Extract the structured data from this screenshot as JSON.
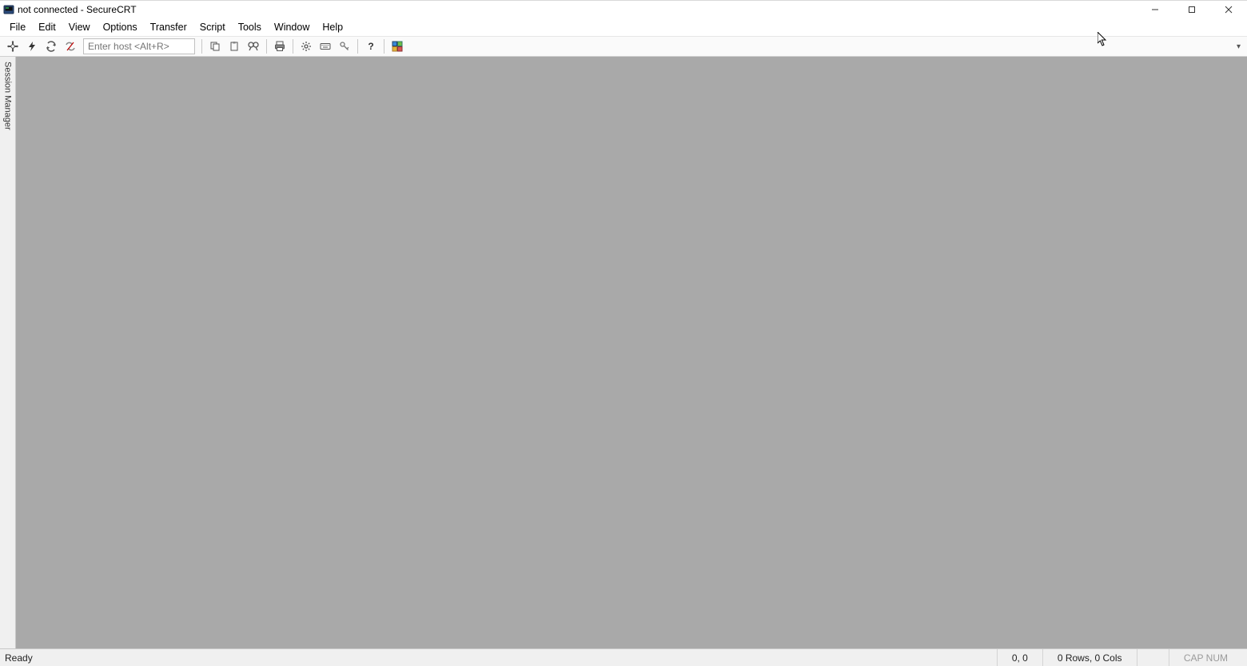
{
  "titlebar": {
    "title": "not connected - SecureCRT"
  },
  "menu": {
    "items": [
      "File",
      "Edit",
      "View",
      "Options",
      "Transfer",
      "Script",
      "Tools",
      "Window",
      "Help"
    ]
  },
  "toolbar": {
    "host_placeholder": "Enter host <Alt+R>",
    "dropdown_glyph": "▾"
  },
  "side_panel": {
    "label": "Session Manager"
  },
  "statusbar": {
    "ready": "Ready",
    "pos": "0, 0",
    "size": "0 Rows, 0 Cols",
    "locks": "CAP  NUM"
  }
}
